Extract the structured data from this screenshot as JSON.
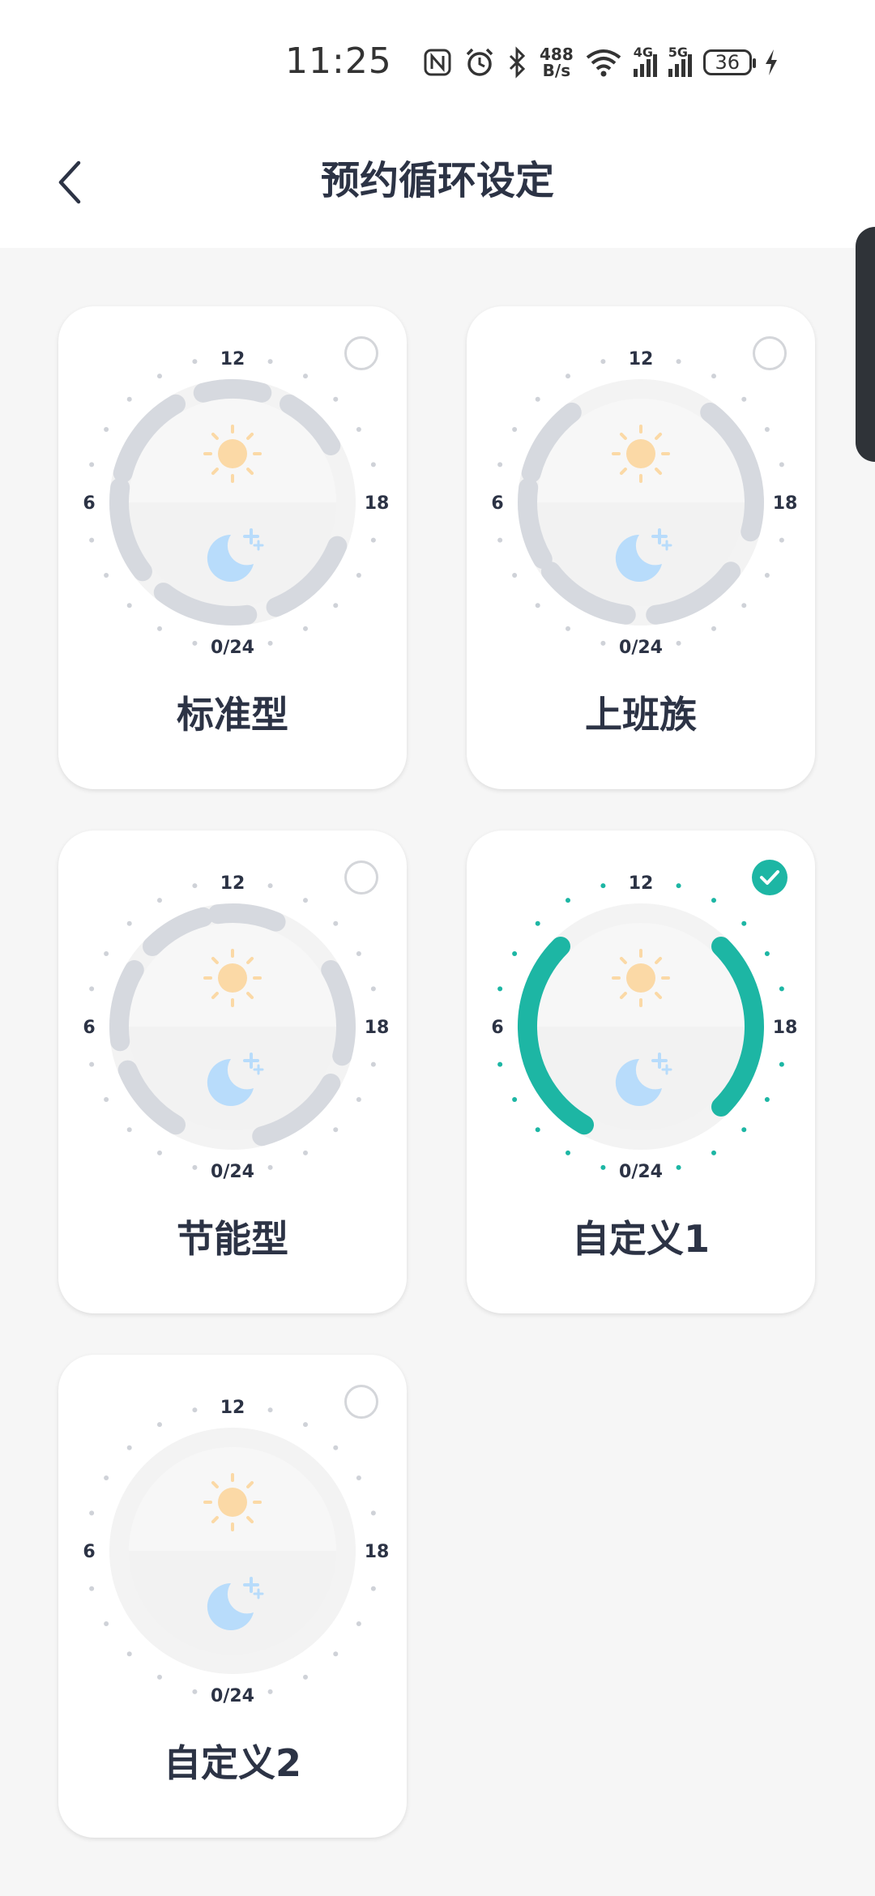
{
  "status_bar": {
    "time": "11:25",
    "net_speed_value": "488",
    "net_speed_unit": "B/s",
    "signal_4g": "4G",
    "signal_5g": "5G",
    "battery": "36",
    "icons": [
      "nfc-icon",
      "alarm-icon",
      "bluetooth-icon",
      "wifi-icon",
      "signal-4g-icon",
      "signal-5g-icon",
      "battery-icon",
      "charging-icon"
    ]
  },
  "header": {
    "title": "预约循环设定",
    "back_icon": "chevron-left-icon"
  },
  "colors": {
    "accent": "#1db6a4",
    "inactive_arc": "#d6d9df",
    "sun": "#fbd9a6",
    "moon": "#b8dcfb",
    "text": "#2c3345"
  },
  "dial_labels": {
    "top": "12",
    "left": "6",
    "right": "18",
    "bottom": "0/24"
  },
  "modes": [
    {
      "label": "标准型",
      "selected": false,
      "segments": [
        [
          19.5,
          22.5
        ],
        [
          23.5,
          2.5
        ],
        [
          3.5,
          6.5
        ],
        [
          7,
          10
        ],
        [
          11,
          13
        ],
        [
          14,
          16
        ]
      ]
    },
    {
      "label": "上班族",
      "selected": false,
      "segments": [
        [
          20.5,
          23.5
        ],
        [
          0.5,
          3.5
        ],
        [
          4,
          6.5
        ],
        [
          7,
          9.5
        ],
        [
          14.5,
          19
        ]
      ]
    },
    {
      "label": "节能型",
      "selected": false,
      "segments": [
        [
          20,
          23
        ],
        [
          2,
          4.5
        ],
        [
          5.5,
          8
        ],
        [
          9,
          11
        ],
        [
          11.5,
          13.5
        ],
        [
          16,
          19
        ]
      ]
    },
    {
      "label": "自定义1",
      "selected": true,
      "segments": [
        [
          2,
          9
        ],
        [
          15,
          21
        ]
      ]
    },
    {
      "label": "自定义2",
      "selected": false,
      "segments": []
    }
  ]
}
